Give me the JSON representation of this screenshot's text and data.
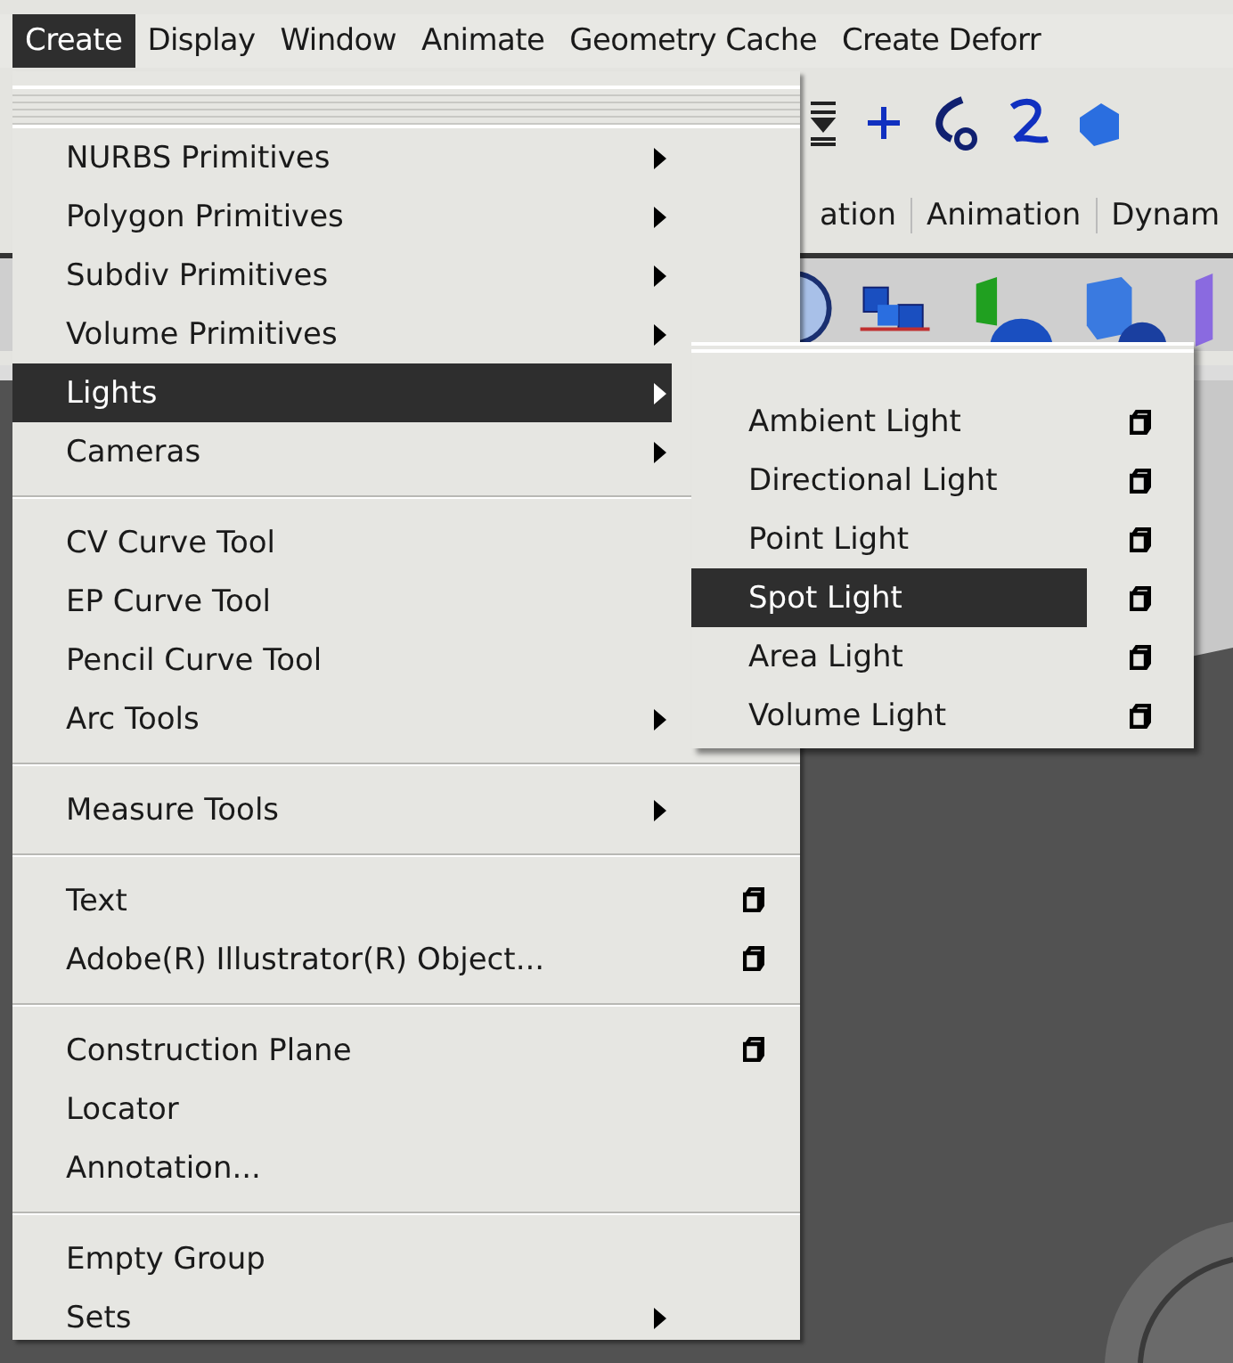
{
  "menubar": [
    {
      "label": "Create",
      "selected": true
    },
    {
      "label": "Display",
      "selected": false
    },
    {
      "label": "Window",
      "selected": false
    },
    {
      "label": "Animate",
      "selected": false
    },
    {
      "label": "Geometry Cache",
      "selected": false
    },
    {
      "label": "Create Deforr",
      "selected": false
    }
  ],
  "shelf_tabs": [
    {
      "label": "ation",
      "selected": false
    },
    {
      "label": "Animation",
      "selected": false
    },
    {
      "label": "Dynam",
      "selected": false
    }
  ],
  "create_menu": {
    "sections": [
      {
        "items": [
          {
            "label": "NURBS Primitives",
            "kind": "submenu",
            "selected": false
          },
          {
            "label": "Polygon Primitives",
            "kind": "submenu",
            "selected": false
          },
          {
            "label": "Subdiv Primitives",
            "kind": "submenu",
            "selected": false
          },
          {
            "label": "Volume Primitives",
            "kind": "submenu",
            "selected": false
          },
          {
            "label": "Lights",
            "kind": "submenu",
            "selected": true
          },
          {
            "label": "Cameras",
            "kind": "submenu",
            "selected": false
          }
        ]
      },
      {
        "items": [
          {
            "label": "CV Curve Tool",
            "kind": "plain",
            "selected": false
          },
          {
            "label": "EP Curve Tool",
            "kind": "plain",
            "selected": false
          },
          {
            "label": "Pencil Curve Tool",
            "kind": "plain",
            "selected": false
          },
          {
            "label": "Arc Tools",
            "kind": "submenu",
            "selected": false
          }
        ]
      },
      {
        "items": [
          {
            "label": "Measure Tools",
            "kind": "submenu",
            "selected": false
          }
        ]
      },
      {
        "items": [
          {
            "label": "Text",
            "kind": "option",
            "selected": false
          },
          {
            "label": "Adobe(R) Illustrator(R) Object...",
            "kind": "option",
            "selected": false
          }
        ]
      },
      {
        "items": [
          {
            "label": "Construction Plane",
            "kind": "option",
            "selected": false
          },
          {
            "label": "Locator",
            "kind": "plain",
            "selected": false
          },
          {
            "label": "Annotation...",
            "kind": "plain",
            "selected": false
          }
        ]
      },
      {
        "items": [
          {
            "label": "Empty Group",
            "kind": "plain",
            "selected": false
          },
          {
            "label": "Sets",
            "kind": "submenu",
            "selected": false
          }
        ]
      }
    ]
  },
  "lights_submenu": {
    "items": [
      {
        "label": "Ambient Light",
        "kind": "option",
        "selected": false
      },
      {
        "label": "Directional Light",
        "kind": "option",
        "selected": false
      },
      {
        "label": "Point Light",
        "kind": "option",
        "selected": false
      },
      {
        "label": "Spot Light",
        "kind": "option",
        "selected": true
      },
      {
        "label": "Area Light",
        "kind": "option",
        "selected": false
      },
      {
        "label": "Volume Light",
        "kind": "option",
        "selected": false
      }
    ]
  }
}
